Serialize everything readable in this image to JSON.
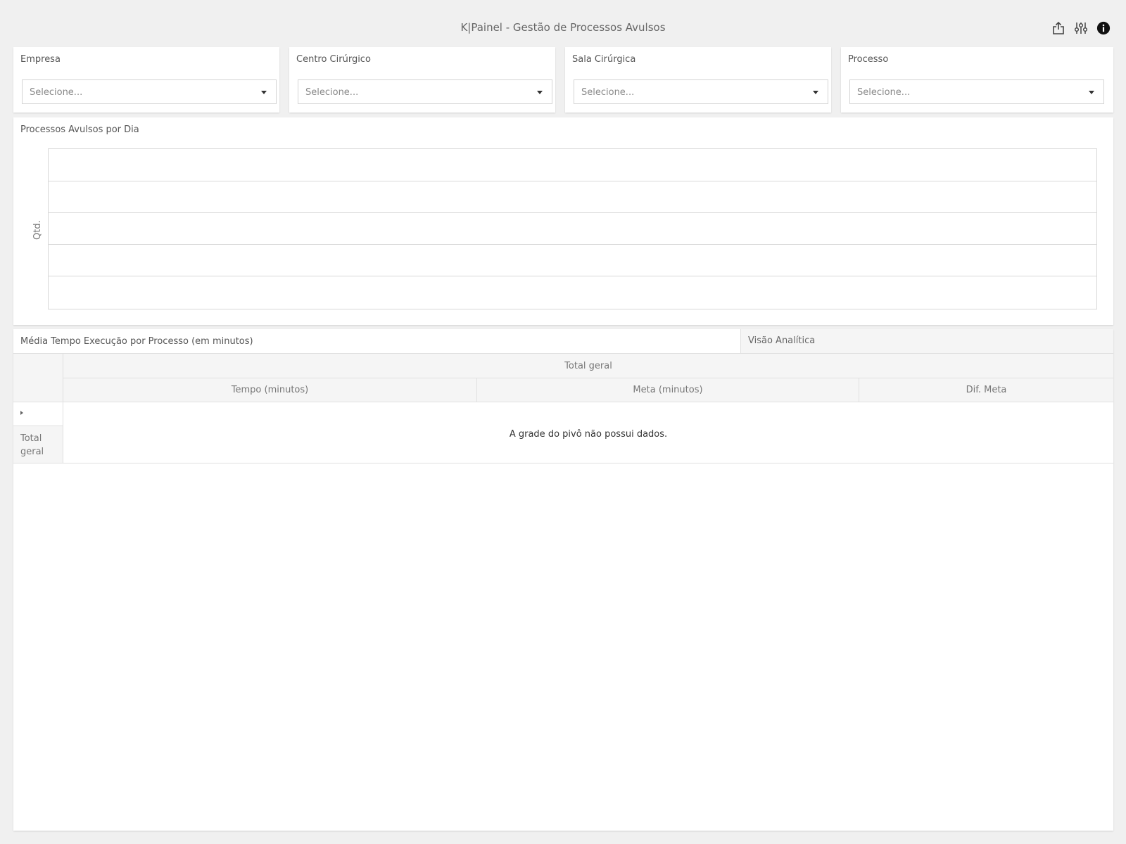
{
  "header": {
    "title": "K|Painel - Gestão de Processos Avulsos",
    "icons": [
      "export-icon",
      "settings-sliders-icon",
      "info-icon"
    ]
  },
  "filters": [
    {
      "label": "Empresa",
      "placeholder": "Selecione..."
    },
    {
      "label": "Centro Cirúrgico",
      "placeholder": "Selecione..."
    },
    {
      "label": "Sala Cirúrgica",
      "placeholder": "Selecione..."
    },
    {
      "label": "Processo",
      "placeholder": "Selecione..."
    }
  ],
  "chart": {
    "title": "Processos Avulsos por Dia",
    "chart_data": {
      "type": "bar",
      "categories": [],
      "values": [],
      "title": "Processos Avulsos por Dia",
      "xlabel": "",
      "ylabel": "Qtd.",
      "grid": true
    }
  },
  "pivot": {
    "title": "Média Tempo Execução por Processo (em minutos)",
    "tab": "Visão Analítica",
    "total_header": "Total geral",
    "columns": [
      "Tempo (minutos)",
      "Meta (minutos)",
      "Dif. Meta"
    ],
    "row_total": "Total geral",
    "empty_message": "A grade do pivô não possui dados."
  },
  "colors": {
    "background": "#f0f0f0",
    "card": "#ffffff",
    "header_cell": "#f5f5f5",
    "border": "#e0e0e0"
  }
}
